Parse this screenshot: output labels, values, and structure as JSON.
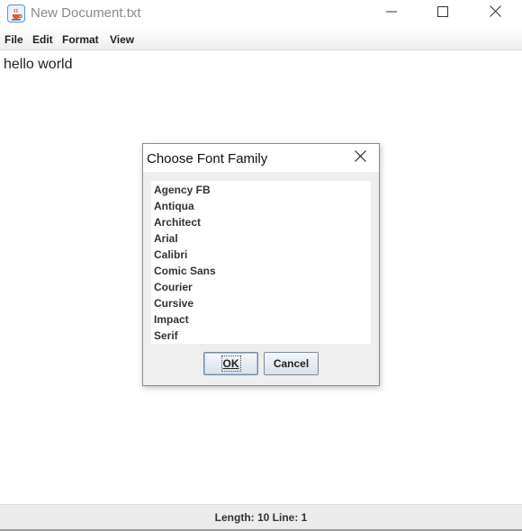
{
  "window": {
    "title": "New Document.txt",
    "icons": {
      "app": "java-cup-icon",
      "minimize": "minimize-icon",
      "maximize": "maximize-icon",
      "close": "close-icon"
    }
  },
  "menu": {
    "items": [
      "File",
      "Edit",
      "Format",
      "View"
    ]
  },
  "editor": {
    "text": "hello world"
  },
  "status": {
    "text": "Length: 10 Line: 1"
  },
  "dialog": {
    "title": "Choose Font Family",
    "fonts": [
      "Agency FB",
      "Antiqua",
      "Architect",
      "Arial",
      "Calibri",
      "Comic Sans",
      "Courier",
      "Cursive",
      "Impact",
      "Serif"
    ],
    "ok_label": "OK",
    "cancel_label": "Cancel"
  }
}
